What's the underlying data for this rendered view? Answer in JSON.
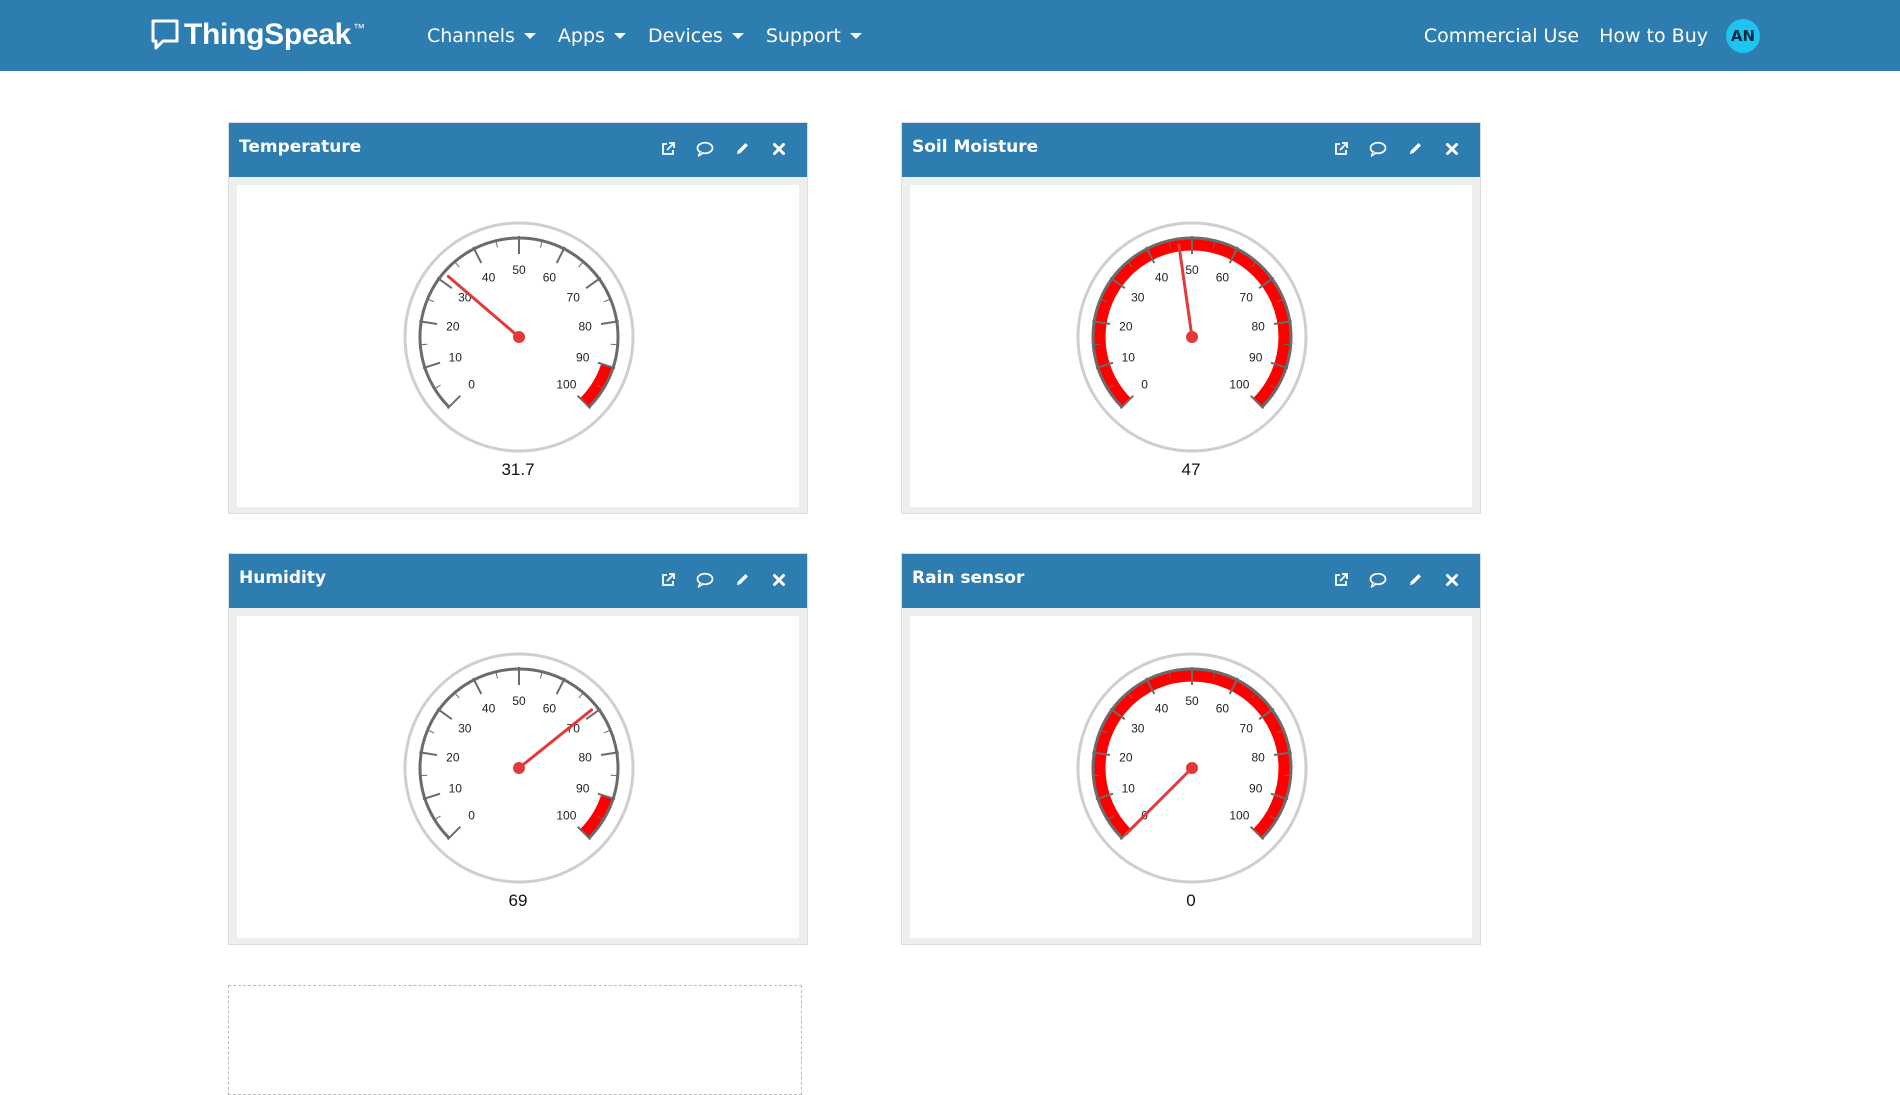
{
  "navbar": {
    "brand": "ThingSpeak",
    "brand_tm": "™",
    "menu": [
      {
        "label": "Channels"
      },
      {
        "label": "Apps"
      },
      {
        "label": "Devices"
      },
      {
        "label": "Support"
      }
    ],
    "right_links": [
      "Commercial Use",
      "How to Buy"
    ],
    "avatar_initials": "AN",
    "colors": {
      "bar": "#2e7db1",
      "avatar": "#1ec3f0"
    }
  },
  "widgets": [
    {
      "title": "Temperature",
      "value": "31.7",
      "reading": 31.7,
      "min": 0,
      "max": 100,
      "red_band": [
        90,
        100
      ]
    },
    {
      "title": "Soil Moisture",
      "value": "47",
      "reading": 47,
      "min": 0,
      "max": 100,
      "red_band": [
        0,
        100
      ]
    },
    {
      "title": "Humidity",
      "value": "69",
      "reading": 69,
      "min": 0,
      "max": 100,
      "red_band": [
        90,
        100
      ]
    },
    {
      "title": "Rain sensor",
      "value": "0",
      "reading": 0,
      "min": 0,
      "max": 100,
      "red_band": [
        0,
        100
      ]
    }
  ],
  "gauge_ticks": [
    "0",
    "10",
    "20",
    "30",
    "40",
    "50",
    "60",
    "70",
    "80",
    "90",
    "100"
  ],
  "widget_icons": [
    "external-link-icon",
    "comment-icon",
    "pencil-icon",
    "close-icon"
  ],
  "colors": {
    "needle": "#e03a3a",
    "band": "#ff0000",
    "scale": "#6b6b6b",
    "header": "#2e7db1"
  }
}
